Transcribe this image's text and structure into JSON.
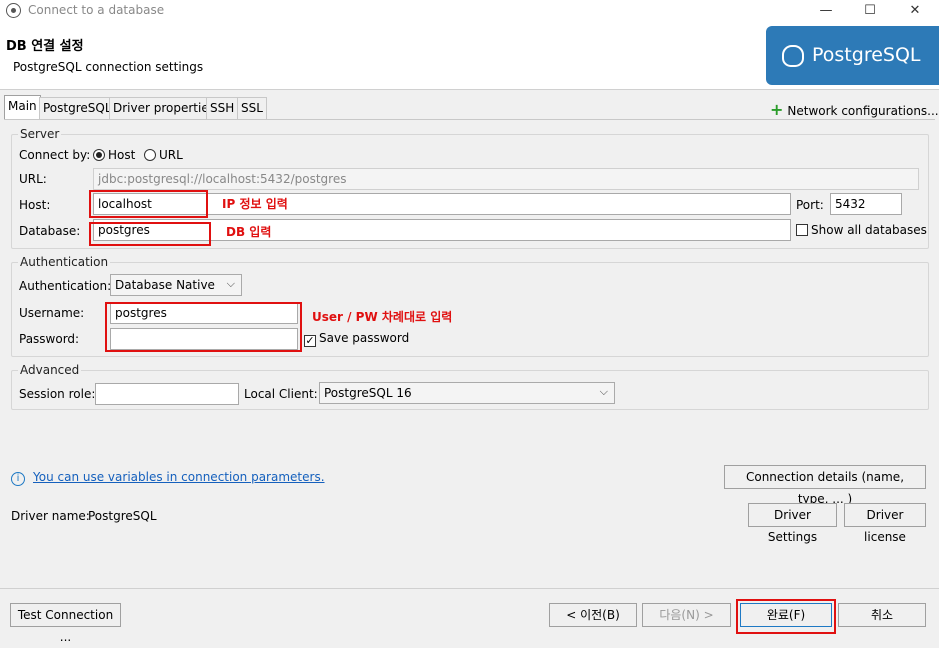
{
  "window": {
    "title": "Connect to a database",
    "minimize": "—",
    "maximize": "☐",
    "close": "✕"
  },
  "header": {
    "title": "DB 연결 설정",
    "subtitle": "PostgreSQL connection settings",
    "logo_text": "PostgreSQL",
    "logo_color": "#2d7ab7"
  },
  "tabs": [
    "Main",
    "PostgreSQL",
    "Driver properties",
    "SSH",
    "SSL"
  ],
  "network_config": "Network configurations...",
  "server": {
    "group_label": "Server",
    "connect_by_label": "Connect by:",
    "option_host": "Host",
    "option_url": "URL",
    "selected": "Host",
    "url_label": "URL:",
    "url_value": "jdbc:postgresql://localhost:5432/postgres",
    "host_label": "Host:",
    "host_value": "localhost",
    "port_label": "Port:",
    "port_value": "5432",
    "database_label": "Database:",
    "database_value": "postgres",
    "show_all_label": "Show all databases",
    "show_all_checked": false
  },
  "authentication": {
    "group_label": "Authentication",
    "auth_label": "Authentication:",
    "auth_value": "Database Native",
    "username_label": "Username:",
    "username_value": "postgres",
    "password_label": "Password:",
    "password_value": "",
    "save_password_label": "Save password",
    "save_password_checked": true
  },
  "advanced": {
    "group_label": "Advanced",
    "session_role_label": "Session role:",
    "session_role_value": "",
    "local_client_label": "Local Client:",
    "local_client_value": "PostgreSQL 16"
  },
  "annotations": {
    "host_note": "IP 정보 입력",
    "db_note": "DB 입력",
    "user_note": "User / PW 차례대로 입력",
    "highlight_color": "#e01010"
  },
  "info": {
    "variables_link": "You can use variables in connection parameters.",
    "connection_details_button": "Connection details (name, type, ... )"
  },
  "driver": {
    "name_label": "Driver name:",
    "name_value": "PostgreSQL",
    "settings_button": "Driver Settings",
    "license_button": "Driver license"
  },
  "footer": {
    "test_connection": "Test Connection ...",
    "back": "< 이전(B)",
    "next": "다음(N) >",
    "finish": "완료(F)",
    "cancel": "취소"
  }
}
